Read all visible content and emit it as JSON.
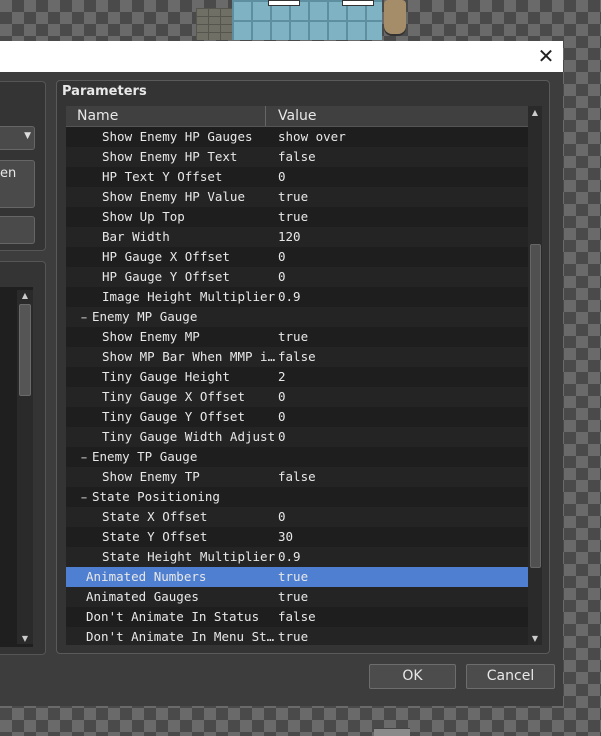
{
  "dialog": {
    "close_glyph": "✕",
    "left_panel": {
      "partial_text": "en",
      "combo_arrow_icon": "chevron-down-icon"
    },
    "parameters": {
      "title": "Parameters",
      "columns": {
        "name": "Name",
        "value": "Value"
      },
      "rows": [
        {
          "name": "Show Enemy HP Gauges",
          "value": "show over",
          "indent": 2,
          "expander": ""
        },
        {
          "name": "Show Enemy HP Text",
          "value": "false",
          "indent": 2,
          "expander": ""
        },
        {
          "name": "HP Text Y Offset",
          "value": "0",
          "indent": 2,
          "expander": ""
        },
        {
          "name": "Show Enemy HP Value",
          "value": "true",
          "indent": 2,
          "expander": ""
        },
        {
          "name": "Show Up Top",
          "value": "true",
          "indent": 2,
          "expander": ""
        },
        {
          "name": "Bar Width",
          "value": "120",
          "indent": 2,
          "expander": ""
        },
        {
          "name": "HP Gauge X Offset",
          "value": "0",
          "indent": 2,
          "expander": ""
        },
        {
          "name": "HP Gauge Y Offset",
          "value": "0",
          "indent": 2,
          "expander": ""
        },
        {
          "name": "Image Height Multiplier",
          "value": "0.9",
          "indent": 2,
          "expander": ""
        },
        {
          "name": "Enemy MP Gauge",
          "value": "",
          "indent": 1,
          "expander": "−"
        },
        {
          "name": "Show Enemy MP",
          "value": "true",
          "indent": 2,
          "expander": ""
        },
        {
          "name": "Show MP Bar When MMP i…",
          "value": "false",
          "indent": 2,
          "expander": ""
        },
        {
          "name": "Tiny Gauge Height",
          "value": "2",
          "indent": 2,
          "expander": ""
        },
        {
          "name": "Tiny Gauge X Offset",
          "value": "0",
          "indent": 2,
          "expander": ""
        },
        {
          "name": "Tiny Gauge Y Offset",
          "value": "0",
          "indent": 2,
          "expander": ""
        },
        {
          "name": "Tiny Gauge Width Adjust",
          "value": "0",
          "indent": 2,
          "expander": ""
        },
        {
          "name": "Enemy TP Gauge",
          "value": "",
          "indent": 1,
          "expander": "−"
        },
        {
          "name": "Show Enemy TP",
          "value": "false",
          "indent": 2,
          "expander": ""
        },
        {
          "name": "State Positioning",
          "value": "",
          "indent": 1,
          "expander": "−"
        },
        {
          "name": "State X Offset",
          "value": "0",
          "indent": 2,
          "expander": ""
        },
        {
          "name": "State Y Offset",
          "value": "30",
          "indent": 2,
          "expander": ""
        },
        {
          "name": "State Height Multiplier",
          "value": "0.9",
          "indent": 2,
          "expander": ""
        },
        {
          "name": "Animated Numbers",
          "value": "true",
          "indent": 0,
          "expander": "",
          "selected": true
        },
        {
          "name": "Animated Gauges",
          "value": "true",
          "indent": 0,
          "expander": ""
        },
        {
          "name": "Don't Animate In Status",
          "value": "false",
          "indent": 0,
          "expander": ""
        },
        {
          "name": "Don't Animate In Menu St…",
          "value": "true",
          "indent": 0,
          "expander": ""
        }
      ]
    },
    "buttons": {
      "ok": "OK",
      "cancel": "Cancel"
    },
    "colors": {
      "selection": "#4f7fd0",
      "panel": "#343434",
      "grid": "#1e1e1e"
    }
  }
}
